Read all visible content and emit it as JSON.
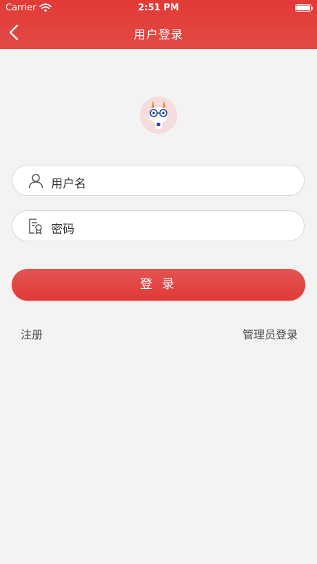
{
  "status_bar": {
    "carrier": "Carrier",
    "time": "2:51 PM"
  },
  "nav": {
    "title": "用户登录"
  },
  "form": {
    "username_placeholder": "用户名",
    "password_placeholder": "密码",
    "login_label": "登 录"
  },
  "links": {
    "register": "注册",
    "admin_login": "管理员登录"
  },
  "colors": {
    "primary": "#e23a36",
    "background": "#f3f3f3"
  },
  "icons": {
    "back": "chevron-left",
    "username": "person-outline",
    "password": "certificate-outline",
    "avatar": "rabbit-mascot"
  }
}
